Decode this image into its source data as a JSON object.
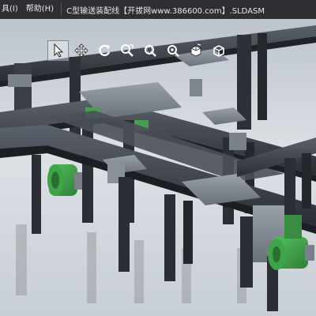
{
  "menubar": {
    "items": [
      "具(I)",
      "帮助(H)"
    ],
    "document_title": "C型输送装配线【开拔网www.386600.com】.SLDASM"
  },
  "heads_up_toolbar": {
    "tools": [
      {
        "icon": "select-arrow-icon",
        "active": true
      },
      {
        "icon": "move-icon",
        "active": false
      },
      {
        "icon": "rotate-icon",
        "active": false
      },
      {
        "icon": "zoom-to-fit-icon",
        "active": false
      },
      {
        "icon": "zoom-to-area-icon",
        "active": false
      },
      {
        "icon": "zoom-in-out-icon",
        "active": false
      },
      {
        "icon": "view-orientation-icon",
        "active": false
      },
      {
        "icon": "display-style-cube-icon",
        "active": false
      }
    ]
  },
  "model": {
    "frame_color": "#3b3f46",
    "plate_color": "#8a9099",
    "motor_color": "#3fa34a"
  }
}
